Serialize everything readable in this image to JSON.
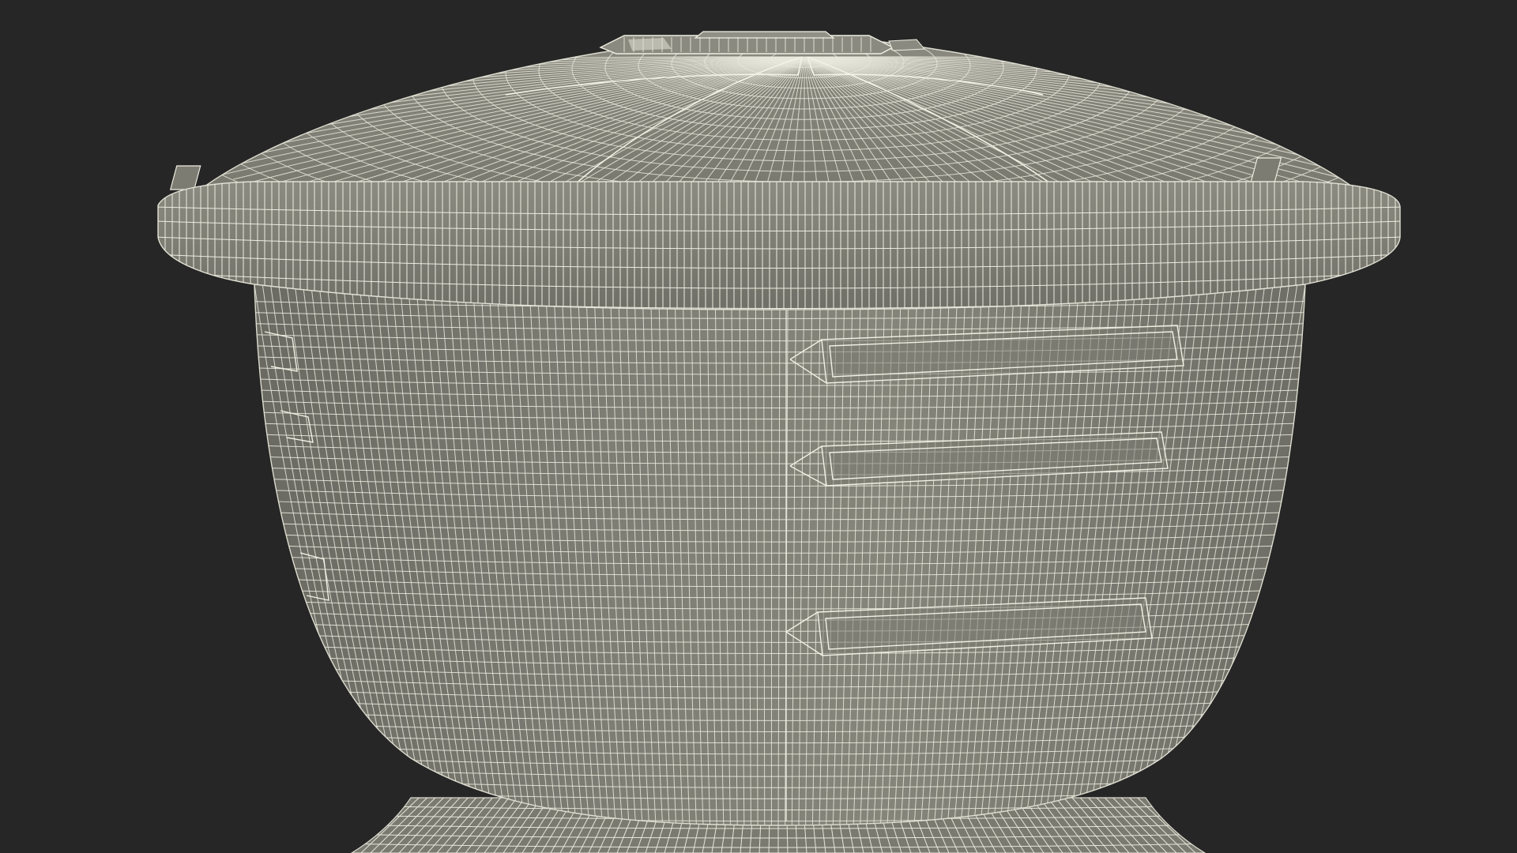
{
  "scene": {
    "subject": "wireframe-water-tank-icon",
    "colors": {
      "background": "#262626",
      "surface": "#7b7b72",
      "surface_dark": "#6c6c64",
      "surface_light": "#8a8a80",
      "wire": "#e8e8dc",
      "shadow": "#55554f"
    }
  }
}
